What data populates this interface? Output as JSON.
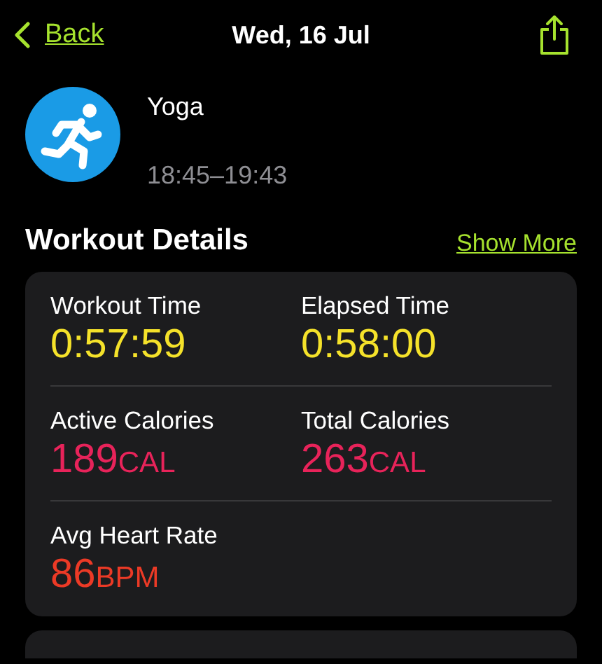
{
  "nav": {
    "back": "Back",
    "title": "Wed, 16 Jul"
  },
  "workout": {
    "name": "Yoga",
    "time": "18:45–19:43"
  },
  "section": {
    "title": "Workout Details",
    "link": "Show More"
  },
  "metrics": [
    [
      {
        "label": "Workout Time",
        "value": "0:57:59",
        "color": "#f5e22a"
      },
      {
        "label": "Elapsed Time",
        "value": "0:58:00",
        "color": "#f5e22a"
      }
    ],
    [
      {
        "label": "Active Calories",
        "value": "189",
        "unit": "CAL",
        "color": "#e8235a"
      },
      {
        "label": "Total Calories",
        "value": "263",
        "unit": "CAL",
        "color": "#e8235a"
      }
    ],
    [
      {
        "label": "Avg Heart Rate",
        "value": "86",
        "unit": "BPM",
        "color": "#ec3a26"
      }
    ]
  ]
}
